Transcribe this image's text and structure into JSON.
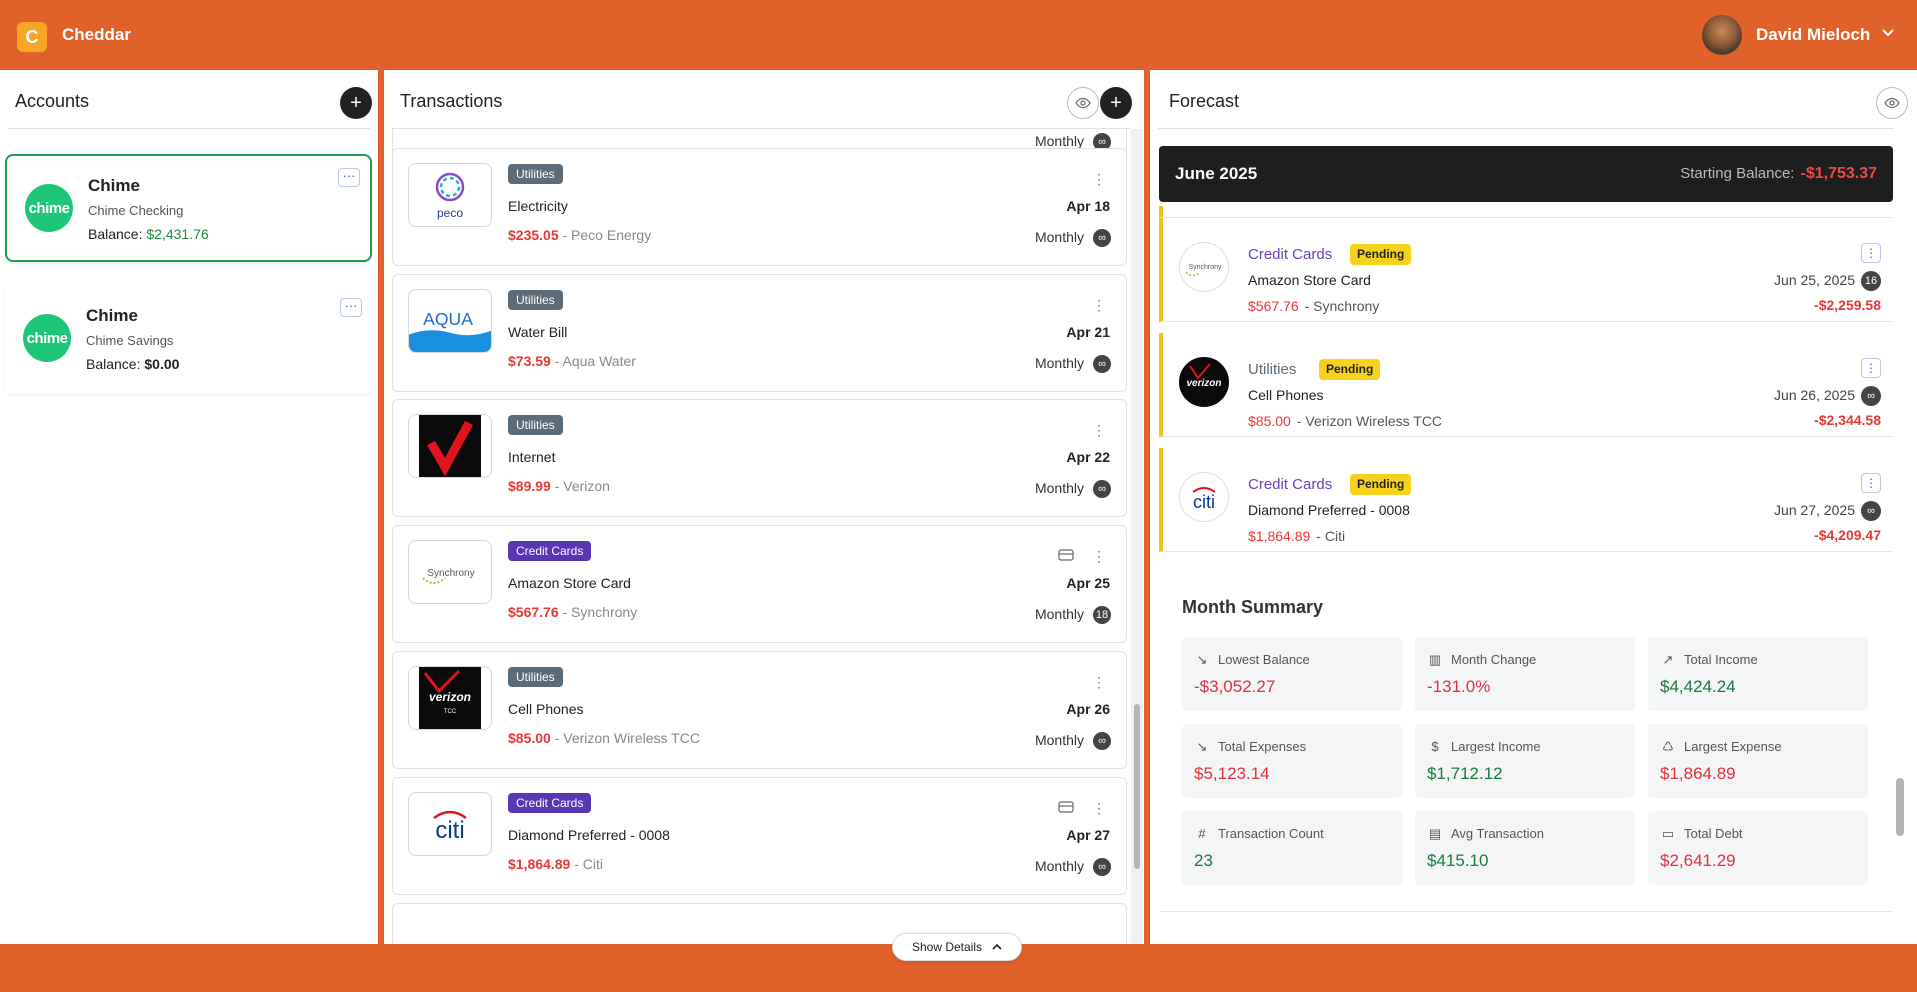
{
  "app": {
    "name": "Cheddar",
    "logo_letter": "C"
  },
  "user": {
    "name": "David Mieloch"
  },
  "accounts": {
    "title": "Accounts",
    "add_label": "+",
    "items": [
      {
        "name": "Chime",
        "logo": "chime",
        "subname": "Chime Checking",
        "balance_label": "Balance:",
        "balance": "$2,431.76",
        "selected": true
      },
      {
        "name": "Chime",
        "logo": "chime",
        "subname": "Chime Savings",
        "balance_label": "Balance:",
        "balance": "$0.00",
        "selected": false
      }
    ],
    "menu_label": "···"
  },
  "transactions": {
    "title": "Transactions",
    "add_label": "+",
    "partial_freq": "Monthly",
    "items": [
      {
        "category": "Utilities",
        "name": "Electricity",
        "amount": "$235.05",
        "payee": "- Peco Energy",
        "date": "Apr 18",
        "freq": "Monthly",
        "count": "∞",
        "logo": "peco",
        "logo_text": "peco",
        "has_card": false
      },
      {
        "category": "Utilities",
        "name": "Water Bill",
        "amount": "$73.59",
        "payee": "- Aqua Water",
        "date": "Apr 21",
        "freq": "Monthly",
        "count": "∞",
        "logo": "aqua",
        "logo_text": "AQUA",
        "has_card": false
      },
      {
        "category": "Utilities",
        "name": "Internet",
        "amount": "$89.99",
        "payee": "- Verizon",
        "date": "Apr 22",
        "freq": "Monthly",
        "count": "∞",
        "logo": "verizon-check",
        "has_card": false
      },
      {
        "category": "Credit Cards",
        "name": "Amazon Store Card",
        "amount": "$567.76",
        "payee": "- Synchrony",
        "date": "Apr 25",
        "freq": "Monthly",
        "count": "18",
        "logo": "synchrony",
        "logo_text": "Synchrony",
        "has_card": true
      },
      {
        "category": "Utilities",
        "name": "Cell Phones",
        "amount": "$85.00",
        "payee": "- Verizon Wireless TCC",
        "date": "Apr 26",
        "freq": "Monthly",
        "count": "∞",
        "logo": "verizon-tcc",
        "logo_text": "verizon",
        "has_card": false
      },
      {
        "category": "Credit Cards",
        "name": "Diamond Preferred - 0008",
        "amount": "$1,864.89",
        "payee": "- Citi",
        "date": "Apr 27",
        "freq": "Monthly",
        "count": "∞",
        "logo": "citi",
        "logo_text": "citi",
        "has_card": true
      }
    ],
    "show_details": "Show Details"
  },
  "forecast": {
    "title": "Forecast",
    "month": "June 2025",
    "starting_label": "Starting Balance:",
    "starting_value": "-$1,753.37",
    "items": [
      {
        "category": "Credit Cards",
        "pending": "Pending",
        "name": "Amazon Store Card",
        "amount": "$567.76",
        "payee": "- Synchrony",
        "date": "Jun 25, 2025",
        "count": "16",
        "balance": "-$2,259.58",
        "logo": "synchrony",
        "logo_text": "Synchrony"
      },
      {
        "category": "Utilities",
        "pending": "Pending",
        "name": "Cell Phones",
        "amount": "$85.00",
        "payee": "- Verizon Wireless TCC",
        "date": "Jun 26, 2025",
        "count": "∞",
        "balance": "-$2,344.58",
        "logo": "verizon",
        "logo_text": "verizon"
      },
      {
        "category": "Credit Cards",
        "pending": "Pending",
        "name": "Diamond Preferred - 0008",
        "amount": "$1,864.89",
        "payee": "- Citi",
        "date": "Jun 27, 2025",
        "count": "∞",
        "balance": "-$4,209.47",
        "logo": "citi",
        "logo_text": "citi"
      }
    ],
    "summary": {
      "title": "Month Summary",
      "stats": [
        {
          "label": "Lowest Balance",
          "value": "-$3,052.27",
          "icon": "trend-down-icon",
          "glyph": "↘",
          "tone": "red"
        },
        {
          "label": "Month Change",
          "value": "-131.0%",
          "icon": "bar-chart-icon",
          "glyph": "▥",
          "tone": "red"
        },
        {
          "label": "Total Income",
          "value": "$4,424.24",
          "icon": "arrow-up-right-icon",
          "glyph": "↗",
          "tone": "green"
        },
        {
          "label": "Total Expenses",
          "value": "$5,123.14",
          "icon": "arrow-down-right-icon",
          "glyph": "↘",
          "tone": "red"
        },
        {
          "label": "Largest Income",
          "value": "$1,712.12",
          "icon": "dollar-circle-icon",
          "glyph": "$",
          "tone": "green"
        },
        {
          "label": "Largest Expense",
          "value": "$1,864.89",
          "icon": "piggy-bank-icon",
          "glyph": "♺",
          "tone": "red"
        },
        {
          "label": "Transaction Count",
          "value": "23",
          "icon": "hash-icon",
          "glyph": "#",
          "tone": "green"
        },
        {
          "label": "Avg Transaction",
          "value": "$415.10",
          "icon": "calculator-icon",
          "glyph": "▤",
          "tone": "green"
        },
        {
          "label": "Total Debt",
          "value": "$2,641.29",
          "icon": "credit-card-icon",
          "glyph": "▭",
          "tone": "red"
        }
      ]
    }
  },
  "colors": {
    "brand": "#e0612a",
    "accent_green": "#1f9d55",
    "negative": "#e53935",
    "pending": "#f7d21c",
    "utilities_badge": "#5b6b78",
    "credit_badge": "#5a36b5"
  }
}
